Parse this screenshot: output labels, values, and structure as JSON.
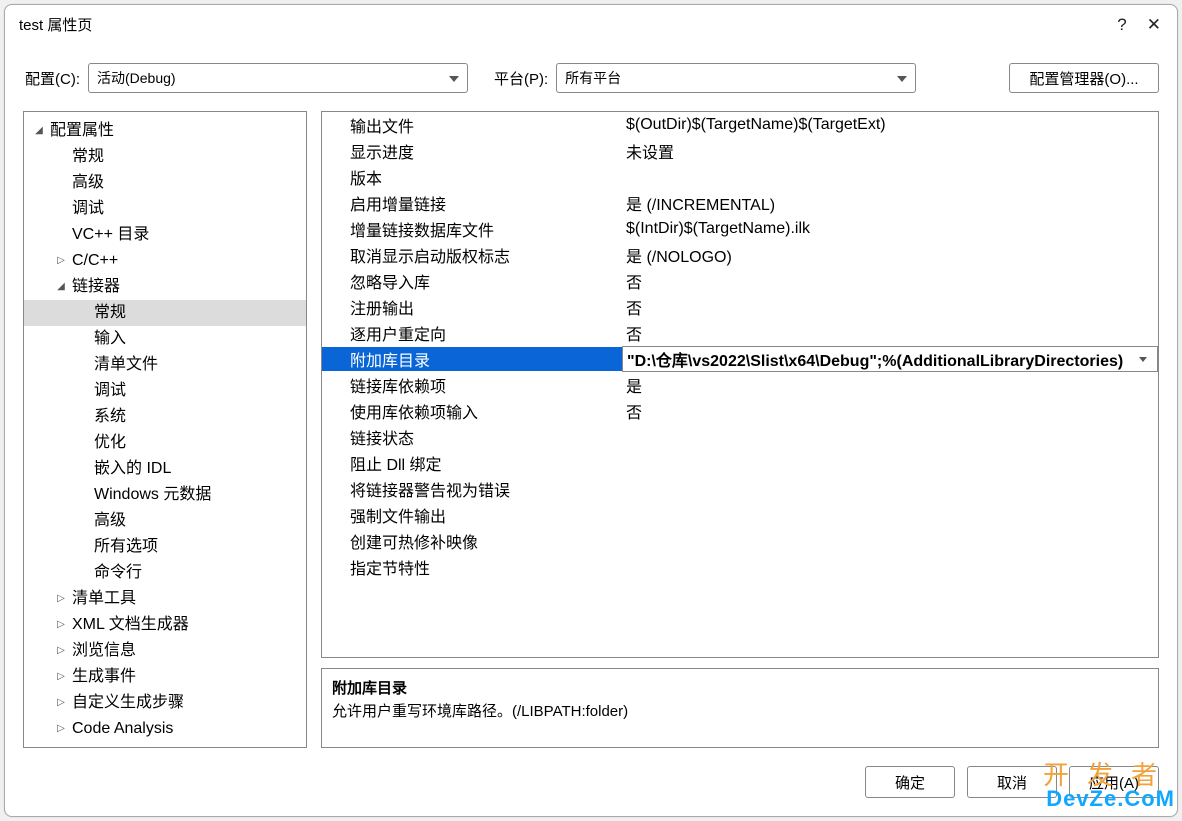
{
  "window": {
    "title": "test 属性页"
  },
  "toolbar": {
    "config_label": "配置(C):",
    "config_value": "活动(Debug)",
    "platform_label": "平台(P):",
    "platform_value": "所有平台",
    "cfg_manager_label": "配置管理器(O)..."
  },
  "tree": {
    "root": {
      "label": "配置属性",
      "expanded": true
    },
    "items": [
      {
        "label": "常规",
        "level": 1
      },
      {
        "label": "高级",
        "level": 1
      },
      {
        "label": "调试",
        "level": 1
      },
      {
        "label": "VC++ 目录",
        "level": 1
      },
      {
        "label": "C/C++",
        "level": 1,
        "caret": "▷"
      },
      {
        "label": "链接器",
        "level": 1,
        "caret": "◢",
        "expanded": true
      },
      {
        "label": "常规",
        "level": 2,
        "selected": true
      },
      {
        "label": "输入",
        "level": 2
      },
      {
        "label": "清单文件",
        "level": 2
      },
      {
        "label": "调试",
        "level": 2
      },
      {
        "label": "系统",
        "level": 2
      },
      {
        "label": "优化",
        "level": 2
      },
      {
        "label": "嵌入的 IDL",
        "level": 2
      },
      {
        "label": "Windows 元数据",
        "level": 2
      },
      {
        "label": "高级",
        "level": 2
      },
      {
        "label": "所有选项",
        "level": 2
      },
      {
        "label": "命令行",
        "level": 2
      },
      {
        "label": "清单工具",
        "level": 1,
        "caret": "▷"
      },
      {
        "label": "XML 文档生成器",
        "level": 1,
        "caret": "▷"
      },
      {
        "label": "浏览信息",
        "level": 1,
        "caret": "▷"
      },
      {
        "label": "生成事件",
        "level": 1,
        "caret": "▷"
      },
      {
        "label": "自定义生成步骤",
        "level": 1,
        "caret": "▷"
      },
      {
        "label": "Code Analysis",
        "level": 1,
        "caret": "▷"
      }
    ]
  },
  "grid": {
    "rows": [
      {
        "name": "输出文件",
        "value": "$(OutDir)$(TargetName)$(TargetExt)"
      },
      {
        "name": "显示进度",
        "value": "未设置"
      },
      {
        "name": "版本",
        "value": ""
      },
      {
        "name": "启用增量链接",
        "value": "是 (/INCREMENTAL)"
      },
      {
        "name": "增量链接数据库文件",
        "value": "$(IntDir)$(TargetName).ilk"
      },
      {
        "name": "取消显示启动版权标志",
        "value": "是 (/NOLOGO)"
      },
      {
        "name": "忽略导入库",
        "value": "否"
      },
      {
        "name": "注册输出",
        "value": "否"
      },
      {
        "name": "逐用户重定向",
        "value": "否"
      },
      {
        "name": "附加库目录",
        "value": "\"D:\\仓库\\vs2022\\Slist\\x64\\Debug\";%(AdditionalLibraryDirectories)",
        "selected": true
      },
      {
        "name": "链接库依赖项",
        "value": "是"
      },
      {
        "name": "使用库依赖项输入",
        "value": "否"
      },
      {
        "name": "链接状态",
        "value": ""
      },
      {
        "name": "阻止 Dll 绑定",
        "value": ""
      },
      {
        "name": "将链接器警告视为错误",
        "value": ""
      },
      {
        "name": "强制文件输出",
        "value": ""
      },
      {
        "name": "创建可热修补映像",
        "value": ""
      },
      {
        "name": "指定节特性",
        "value": ""
      }
    ]
  },
  "help": {
    "title": "附加库目录",
    "body": "允许用户重写环境库路径。(/LIBPATH:folder)"
  },
  "buttons": {
    "ok": "确定",
    "cancel": "取消",
    "apply": "应用(A)"
  },
  "watermark": {
    "line1": "开发者",
    "line2": "DevZe.CoM"
  }
}
